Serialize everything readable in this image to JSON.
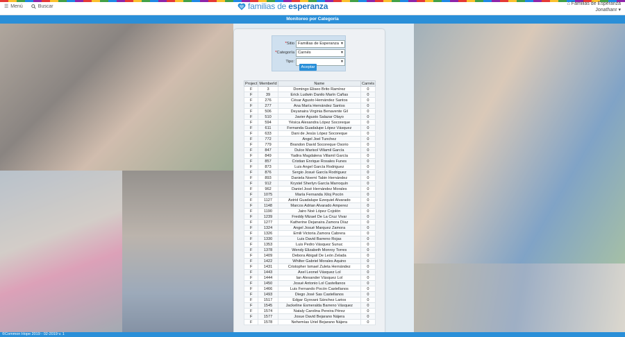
{
  "header": {
    "menu_label": "Menú",
    "search_label": "Buscar",
    "logo_light": "familias de ",
    "logo_bold": "esperanza",
    "org_name": "Familias de Esperanza",
    "user_name": "Jonathanr"
  },
  "title": "Monitoreo por Categoría",
  "form": {
    "sitio_label": "Sitio",
    "sitio_value": "Familias de Esperanza",
    "categoria_label": "Categoría",
    "categoria_value": "Carnés",
    "tipo_label": "Tipo",
    "tipo_value": "",
    "submit_label": "Aceptar"
  },
  "table": {
    "headers": [
      "Project",
      "MemberId",
      "Name",
      "Carnés"
    ],
    "rows": [
      [
        "F",
        "3",
        "Domingo Eliseo Brito Ramírez",
        "0"
      ],
      [
        "F",
        "39",
        "Erick Ludwin Danilo Marín Cañas",
        "0"
      ],
      [
        "F",
        "276",
        "César Agusto Hernández Santos",
        "0"
      ],
      [
        "F",
        "277",
        "Ana María Hernández Santos",
        "0"
      ],
      [
        "F",
        "506",
        "Deyanaira Virginia Benavente Gil",
        "0"
      ],
      [
        "F",
        "510",
        "Javier Agusto Salazar Olayo",
        "0"
      ],
      [
        "F",
        "594",
        "Yésica Alexandra López Socoreque",
        "0"
      ],
      [
        "F",
        "611",
        "Fernanda Guadalupe López Vásquez",
        "0"
      ],
      [
        "F",
        "633",
        "Dani de Jesús López Socoreque",
        "0"
      ],
      [
        "F",
        "772",
        "Angel Joel Tunchez",
        "0"
      ],
      [
        "F",
        "779",
        "Brandon David Socoreque Osorio",
        "0"
      ],
      [
        "F",
        "847",
        "Dulce Marisol Villamil García",
        "0"
      ],
      [
        "F",
        "849",
        "Yadira Magdalena Villamil García",
        "0"
      ],
      [
        "F",
        "857",
        "Cristian Enrique Rosales Funes",
        "0"
      ],
      [
        "F",
        "873",
        "Luis Angel García Rodriguez",
        "0"
      ],
      [
        "F",
        "876",
        "Sergio Josué García Rodriguez",
        "0"
      ],
      [
        "F",
        "893",
        "Daniela Noemí Tabin Hernández",
        "0"
      ],
      [
        "F",
        "912",
        "Krystel Sherlyn García Marroquín",
        "0"
      ],
      [
        "F",
        "962",
        "Daniel José Hernández Morales",
        "0"
      ],
      [
        "F",
        "1075",
        "María Fernanda Xiloj Pocón",
        "0"
      ],
      [
        "F",
        "1127",
        "Astrid Guadalupe Ezequiel Alvarado",
        "0"
      ],
      [
        "F",
        "1148",
        "Marcos Adrian Alvarado Amperez",
        "0"
      ],
      [
        "F",
        "1190",
        "Jairo Noé López Cojolón",
        "0"
      ],
      [
        "F",
        "1239",
        "Freddy Mizael De La Cruz Vivar",
        "0"
      ],
      [
        "F",
        "1277",
        "Katherine Dejanaira Zamora Díaz",
        "0"
      ],
      [
        "F",
        "1324",
        "Angel Josué Marquez Zamora",
        "0"
      ],
      [
        "F",
        "1326",
        "Emili Victoria Zamora Cabrera",
        "0"
      ],
      [
        "F",
        "1330",
        "Luis David Barreno Rojas",
        "0"
      ],
      [
        "F",
        "1353",
        "Luis Pedro Vásquez Sunuc",
        "0"
      ],
      [
        "F",
        "1378",
        "Wendy Elizabeth Monroy Torres",
        "0"
      ],
      [
        "F",
        "1409",
        "Debora Abigail De León Zelada",
        "0"
      ],
      [
        "F",
        "1422",
        "Whilter Gabriel Morales Aquino",
        "0"
      ],
      [
        "F",
        "1431",
        "Cristopher Ismael Zuleta Hernández",
        "0"
      ],
      [
        "F",
        "1443",
        "Axel Leonel Vásquez Lol",
        "0"
      ],
      [
        "F",
        "1444",
        "Ian Alexander Vásquez Lol",
        "0"
      ],
      [
        "F",
        "1450",
        "Josué Antonio Lol Castellanos",
        "0"
      ],
      [
        "F",
        "1466",
        "Luis Fernando Pocón Castellanos",
        "0"
      ],
      [
        "F",
        "1493",
        "Diego José Sas Castellanos",
        "0"
      ],
      [
        "F",
        "1517",
        "Edgar Gyovani Sánchez Larios",
        "0"
      ],
      [
        "F",
        "1545",
        "Jackeline Esmeralda Barreno Vásquez",
        "0"
      ],
      [
        "F",
        "1574",
        "Nataly Carolina Pereira Pérez",
        "0"
      ],
      [
        "F",
        "1577",
        "Josue David Bejarano Nájera",
        "0"
      ],
      [
        "F",
        "1578",
        "Nehemías Uriel Bejarano Nájera",
        "0"
      ]
    ]
  },
  "footer": "©Common Hope 2019 - 02-2019 v. 1",
  "colors": {
    "brand_blue": "#2a8fd8",
    "logo_blue": "#3d8ed0"
  }
}
